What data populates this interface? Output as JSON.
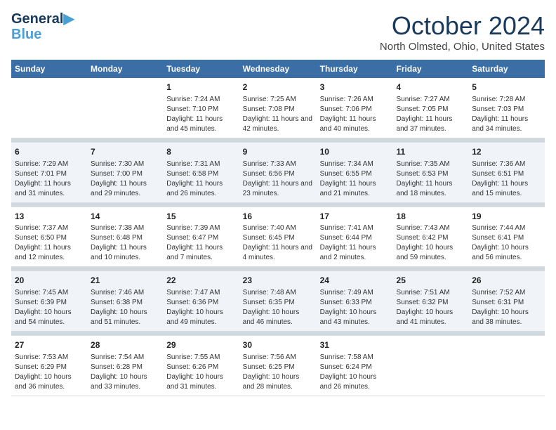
{
  "header": {
    "logo_line1": "General",
    "logo_line2": "Blue",
    "month": "October 2024",
    "location": "North Olmsted, Ohio, United States"
  },
  "columns": [
    "Sunday",
    "Monday",
    "Tuesday",
    "Wednesday",
    "Thursday",
    "Friday",
    "Saturday"
  ],
  "weeks": [
    [
      {
        "day": "",
        "sunrise": "",
        "sunset": "",
        "daylight": ""
      },
      {
        "day": "",
        "sunrise": "",
        "sunset": "",
        "daylight": ""
      },
      {
        "day": "1",
        "sunrise": "Sunrise: 7:24 AM",
        "sunset": "Sunset: 7:10 PM",
        "daylight": "Daylight: 11 hours and 45 minutes."
      },
      {
        "day": "2",
        "sunrise": "Sunrise: 7:25 AM",
        "sunset": "Sunset: 7:08 PM",
        "daylight": "Daylight: 11 hours and 42 minutes."
      },
      {
        "day": "3",
        "sunrise": "Sunrise: 7:26 AM",
        "sunset": "Sunset: 7:06 PM",
        "daylight": "Daylight: 11 hours and 40 minutes."
      },
      {
        "day": "4",
        "sunrise": "Sunrise: 7:27 AM",
        "sunset": "Sunset: 7:05 PM",
        "daylight": "Daylight: 11 hours and 37 minutes."
      },
      {
        "day": "5",
        "sunrise": "Sunrise: 7:28 AM",
        "sunset": "Sunset: 7:03 PM",
        "daylight": "Daylight: 11 hours and 34 minutes."
      }
    ],
    [
      {
        "day": "6",
        "sunrise": "Sunrise: 7:29 AM",
        "sunset": "Sunset: 7:01 PM",
        "daylight": "Daylight: 11 hours and 31 minutes."
      },
      {
        "day": "7",
        "sunrise": "Sunrise: 7:30 AM",
        "sunset": "Sunset: 7:00 PM",
        "daylight": "Daylight: 11 hours and 29 minutes."
      },
      {
        "day": "8",
        "sunrise": "Sunrise: 7:31 AM",
        "sunset": "Sunset: 6:58 PM",
        "daylight": "Daylight: 11 hours and 26 minutes."
      },
      {
        "day": "9",
        "sunrise": "Sunrise: 7:33 AM",
        "sunset": "Sunset: 6:56 PM",
        "daylight": "Daylight: 11 hours and 23 minutes."
      },
      {
        "day": "10",
        "sunrise": "Sunrise: 7:34 AM",
        "sunset": "Sunset: 6:55 PM",
        "daylight": "Daylight: 11 hours and 21 minutes."
      },
      {
        "day": "11",
        "sunrise": "Sunrise: 7:35 AM",
        "sunset": "Sunset: 6:53 PM",
        "daylight": "Daylight: 11 hours and 18 minutes."
      },
      {
        "day": "12",
        "sunrise": "Sunrise: 7:36 AM",
        "sunset": "Sunset: 6:51 PM",
        "daylight": "Daylight: 11 hours and 15 minutes."
      }
    ],
    [
      {
        "day": "13",
        "sunrise": "Sunrise: 7:37 AM",
        "sunset": "Sunset: 6:50 PM",
        "daylight": "Daylight: 11 hours and 12 minutes."
      },
      {
        "day": "14",
        "sunrise": "Sunrise: 7:38 AM",
        "sunset": "Sunset: 6:48 PM",
        "daylight": "Daylight: 11 hours and 10 minutes."
      },
      {
        "day": "15",
        "sunrise": "Sunrise: 7:39 AM",
        "sunset": "Sunset: 6:47 PM",
        "daylight": "Daylight: 11 hours and 7 minutes."
      },
      {
        "day": "16",
        "sunrise": "Sunrise: 7:40 AM",
        "sunset": "Sunset: 6:45 PM",
        "daylight": "Daylight: 11 hours and 4 minutes."
      },
      {
        "day": "17",
        "sunrise": "Sunrise: 7:41 AM",
        "sunset": "Sunset: 6:44 PM",
        "daylight": "Daylight: 11 hours and 2 minutes."
      },
      {
        "day": "18",
        "sunrise": "Sunrise: 7:43 AM",
        "sunset": "Sunset: 6:42 PM",
        "daylight": "Daylight: 10 hours and 59 minutes."
      },
      {
        "day": "19",
        "sunrise": "Sunrise: 7:44 AM",
        "sunset": "Sunset: 6:41 PM",
        "daylight": "Daylight: 10 hours and 56 minutes."
      }
    ],
    [
      {
        "day": "20",
        "sunrise": "Sunrise: 7:45 AM",
        "sunset": "Sunset: 6:39 PM",
        "daylight": "Daylight: 10 hours and 54 minutes."
      },
      {
        "day": "21",
        "sunrise": "Sunrise: 7:46 AM",
        "sunset": "Sunset: 6:38 PM",
        "daylight": "Daylight: 10 hours and 51 minutes."
      },
      {
        "day": "22",
        "sunrise": "Sunrise: 7:47 AM",
        "sunset": "Sunset: 6:36 PM",
        "daylight": "Daylight: 10 hours and 49 minutes."
      },
      {
        "day": "23",
        "sunrise": "Sunrise: 7:48 AM",
        "sunset": "Sunset: 6:35 PM",
        "daylight": "Daylight: 10 hours and 46 minutes."
      },
      {
        "day": "24",
        "sunrise": "Sunrise: 7:49 AM",
        "sunset": "Sunset: 6:33 PM",
        "daylight": "Daylight: 10 hours and 43 minutes."
      },
      {
        "day": "25",
        "sunrise": "Sunrise: 7:51 AM",
        "sunset": "Sunset: 6:32 PM",
        "daylight": "Daylight: 10 hours and 41 minutes."
      },
      {
        "day": "26",
        "sunrise": "Sunrise: 7:52 AM",
        "sunset": "Sunset: 6:31 PM",
        "daylight": "Daylight: 10 hours and 38 minutes."
      }
    ],
    [
      {
        "day": "27",
        "sunrise": "Sunrise: 7:53 AM",
        "sunset": "Sunset: 6:29 PM",
        "daylight": "Daylight: 10 hours and 36 minutes."
      },
      {
        "day": "28",
        "sunrise": "Sunrise: 7:54 AM",
        "sunset": "Sunset: 6:28 PM",
        "daylight": "Daylight: 10 hours and 33 minutes."
      },
      {
        "day": "29",
        "sunrise": "Sunrise: 7:55 AM",
        "sunset": "Sunset: 6:26 PM",
        "daylight": "Daylight: 10 hours and 31 minutes."
      },
      {
        "day": "30",
        "sunrise": "Sunrise: 7:56 AM",
        "sunset": "Sunset: 6:25 PM",
        "daylight": "Daylight: 10 hours and 28 minutes."
      },
      {
        "day": "31",
        "sunrise": "Sunrise: 7:58 AM",
        "sunset": "Sunset: 6:24 PM",
        "daylight": "Daylight: 10 hours and 26 minutes."
      },
      {
        "day": "",
        "sunrise": "",
        "sunset": "",
        "daylight": ""
      },
      {
        "day": "",
        "sunrise": "",
        "sunset": "",
        "daylight": ""
      }
    ]
  ]
}
